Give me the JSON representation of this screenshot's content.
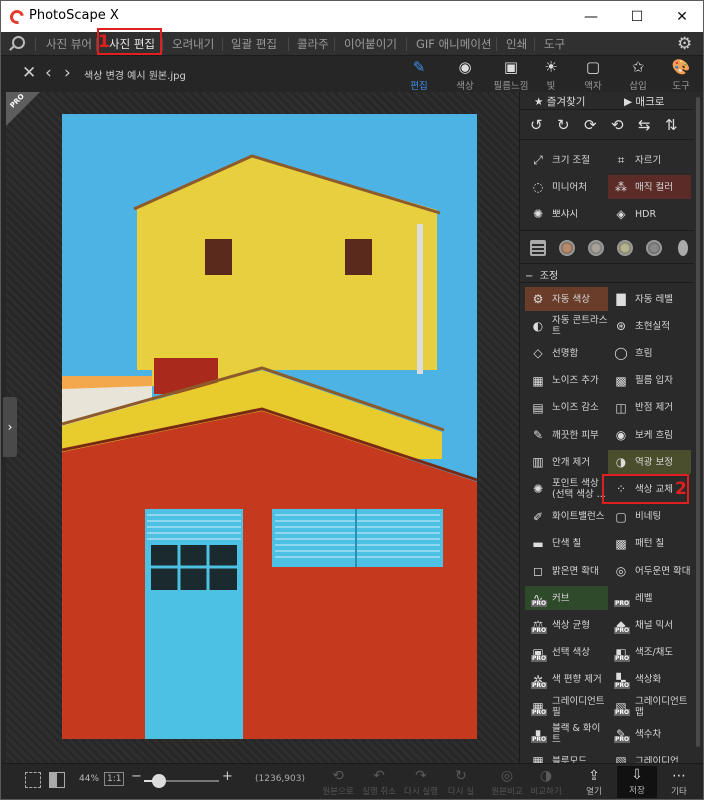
{
  "title_bar": {
    "app_title": "PhotoScape X",
    "minimize": "—",
    "maximize": "☐",
    "close": "✕"
  },
  "menu": {
    "items": [
      "사진 뷰어",
      "사진 편집",
      "오려내기",
      "일괄 편집",
      "콜라주",
      "이어붙이기",
      "GIF 애니메이션",
      "인쇄",
      "도구"
    ],
    "active": "사진 편집"
  },
  "annotations": {
    "marker_1": "1",
    "marker_2": "2"
  },
  "toolbar": {
    "file_name": "색상 변경 예시 원본.jpg",
    "tools": [
      {
        "label": "편집",
        "icon": "edit-icon"
      },
      {
        "label": "색상",
        "icon": "circle-icon"
      },
      {
        "label": "필름느낌",
        "icon": "film-icon"
      },
      {
        "label": "빛",
        "icon": "sun-icon"
      },
      {
        "label": "액자",
        "icon": "frame-icon"
      },
      {
        "label": "삽입",
        "icon": "star-icon"
      },
      {
        "label": "도구",
        "icon": "palette-icon"
      }
    ]
  },
  "canvas": {
    "pro_badge": "PRO",
    "side_tab": "›"
  },
  "panel": {
    "tabs": {
      "favorites": "즐겨찾기",
      "macro": "매크로"
    },
    "rotate_icons": [
      "↺",
      "↻",
      "⟳",
      "⟲",
      "⇆",
      "⇅"
    ],
    "tools_top": [
      {
        "label": "크기 조절",
        "icon": "resize-icon"
      },
      {
        "label": "자르기",
        "icon": "crop-icon"
      },
      {
        "label": "미니어처",
        "icon": "miniature-icon"
      },
      {
        "label": "매직 컬러",
        "icon": "magic-color-icon"
      },
      {
        "label": "뽀샤시",
        "icon": "bloom-icon"
      },
      {
        "label": "HDR",
        "icon": "hdr-icon"
      }
    ],
    "section_title": "조정",
    "section_toggle": "−",
    "adjust_items": [
      {
        "label": "자동 색상",
        "icon": "auto-color-icon",
        "hl": "hl2"
      },
      {
        "label": "자동 레벨",
        "icon": "auto-level-icon",
        "hl": ""
      },
      {
        "label": "자동 콘트라스트",
        "icon": "contrast-icon",
        "hl": ""
      },
      {
        "label": "초현실적",
        "icon": "surreal-icon",
        "hl": ""
      },
      {
        "label": "선명함",
        "icon": "sharpen-icon",
        "hl": ""
      },
      {
        "label": "흐림",
        "icon": "blur-icon",
        "hl": ""
      },
      {
        "label": "노이즈 추가",
        "icon": "noise-add-icon",
        "hl": ""
      },
      {
        "label": "필름 입자",
        "icon": "film-grain-icon",
        "hl": ""
      },
      {
        "label": "노이즈 감소",
        "icon": "noise-reduce-icon",
        "hl": ""
      },
      {
        "label": "반점 제거",
        "icon": "spot-remove-icon",
        "hl": ""
      },
      {
        "label": "깨끗한 피부",
        "icon": "skin-icon",
        "hl": ""
      },
      {
        "label": "보케 흐림",
        "icon": "bokeh-icon",
        "hl": ""
      },
      {
        "label": "안개 제거",
        "icon": "dehaze-icon",
        "hl": ""
      },
      {
        "label": "역광 보정",
        "icon": "backlight-icon",
        "hl": "hl3"
      },
      {
        "label": "포인트 색상 (선택 색상 ...",
        "icon": "point-color-icon",
        "hl": ""
      },
      {
        "label": "색상 교체",
        "icon": "color-replace-icon",
        "hl": ""
      },
      {
        "label": "화이트밸런스",
        "icon": "white-balance-icon",
        "hl": ""
      },
      {
        "label": "비네팅",
        "icon": "vignette-icon",
        "hl": ""
      },
      {
        "label": "단색 칠",
        "icon": "fill-icon",
        "hl": ""
      },
      {
        "label": "패턴 칠",
        "icon": "pattern-icon",
        "hl": ""
      },
      {
        "label": "밝은면 확대",
        "icon": "highlight-expand-icon",
        "hl": ""
      },
      {
        "label": "어두운면 확대",
        "icon": "shadow-expand-icon",
        "hl": ""
      },
      {
        "label": "커브",
        "icon": "curves-icon",
        "hl": "hl4"
      },
      {
        "label": "레벨",
        "icon": "levels-icon",
        "hl": ""
      },
      {
        "label": "색상 균형",
        "icon": "color-balance-icon",
        "hl": ""
      },
      {
        "label": "채널 믹서",
        "icon": "channel-mixer-icon",
        "hl": ""
      },
      {
        "label": "선택 색상",
        "icon": "selective-color-icon",
        "hl": ""
      },
      {
        "label": "색조/채도",
        "icon": "hue-saturation-icon",
        "hl": ""
      },
      {
        "label": "색 편향 제거",
        "icon": "color-cast-icon",
        "hl": ""
      },
      {
        "label": "색상화",
        "icon": "colorize-icon",
        "hl": ""
      },
      {
        "label": "그레이디언트 필",
        "icon": "gradient-fill-icon",
        "hl": ""
      },
      {
        "label": "그레이디언트 맵",
        "icon": "gradient-map-icon",
        "hl": ""
      },
      {
        "label": "블랙 & 화이트",
        "icon": "black-white-icon",
        "hl": ""
      },
      {
        "label": "색수차",
        "icon": "chromatic-icon",
        "hl": ""
      },
      {
        "label": "블루모드",
        "icon": "blur-mode-icon",
        "hl": ""
      },
      {
        "label": "그레이디언",
        "icon": "gradient-icon",
        "hl": ""
      }
    ]
  },
  "bottom": {
    "zoom": "44%",
    "fit": "1:1",
    "minus": "−",
    "plus": "+",
    "zoom_level": 0.2,
    "coords": "(1236,903)",
    "actions": [
      {
        "label": "원본으로",
        "icon": "undo-all-icon",
        "on": false
      },
      {
        "label": "실행 취소",
        "icon": "undo-icon",
        "on": false
      },
      {
        "label": "다시 실행",
        "icon": "redo-icon",
        "on": false
      },
      {
        "label": "다시 실",
        "icon": "repeat-icon",
        "on": false
      },
      {
        "label": "원본비교",
        "icon": "compare-icon",
        "on": false
      },
      {
        "label": "비교하기",
        "icon": "compare2-icon",
        "on": false
      },
      {
        "label": "열기",
        "icon": "open-icon",
        "on": true
      },
      {
        "label": "저장",
        "icon": "save-icon",
        "on": true
      },
      {
        "label": "기타",
        "icon": "more-icon",
        "on": true
      }
    ]
  },
  "colors": {
    "accent": "#3d8ee8",
    "highlight_red": "#e02020",
    "sky": "#4db3e4",
    "yellow_wall": "#e8cf3e",
    "red_wall": "#c53a1f",
    "door": "#4cc1e3"
  }
}
